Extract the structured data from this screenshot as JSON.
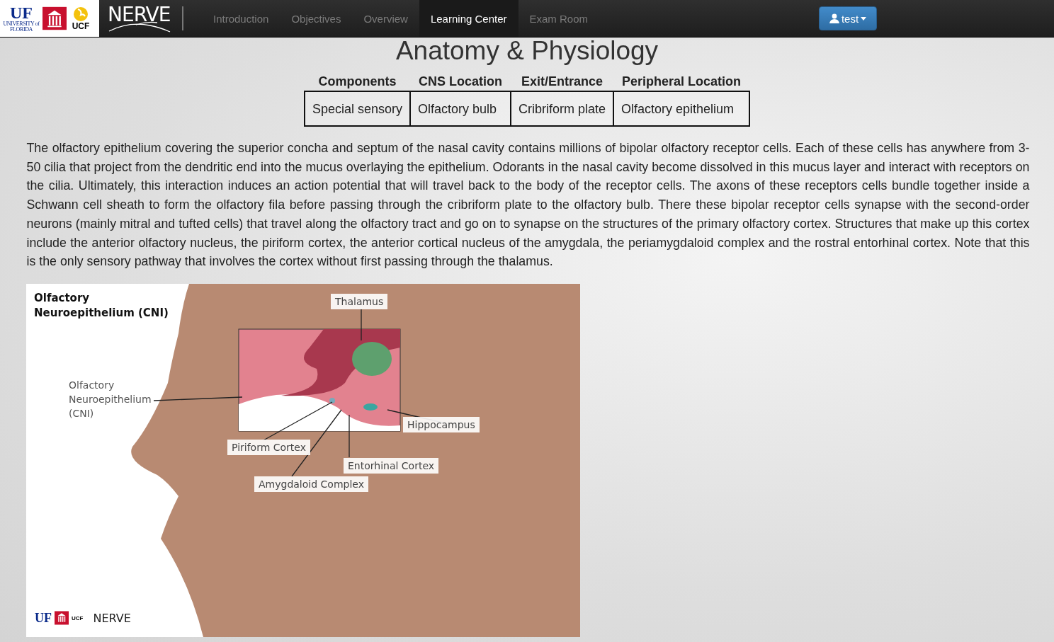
{
  "navbar": {
    "logos": {
      "uf": "UF",
      "uf_sub": "UNIVERSITY of FLORIDA",
      "ucf": "UCF"
    },
    "brand": "NERVE",
    "items": [
      {
        "label": "Introduction",
        "selected": false
      },
      {
        "label": "Objectives",
        "selected": false
      },
      {
        "label": "Overview",
        "selected": false
      },
      {
        "label": "Learning Center",
        "selected": true
      },
      {
        "label": "Exam Room",
        "selected": false
      }
    ],
    "user_button": "test"
  },
  "title": "Anatomy & Physiology",
  "summary_table": {
    "columns": [
      "Components",
      "CNS Location",
      "Exit/Entrance",
      "Peripheral Location"
    ],
    "row": [
      "Special sensory",
      "Olfactory bulb",
      "Cribriform plate",
      "Olfactory epithelium"
    ]
  },
  "description": "The olfactory epithelium covering the superior concha and septum of the nasal cavity contains millions of bipolar olfactory receptor cells. Each of these cells has anywhere from 3-50 cilia that project from the dendritic end into the mucus overlaying the epithelium. Odorants in the nasal cavity become dissolved in this mucus layer and interact with receptors on the cilia. Ultimately, this interaction induces an action potential that will travel back to the body of the receptor cells. The axons of these receptors cells bundle together inside a Schwann cell sheath to form the olfactory fila before passing through the cribriform plate to the olfactory bulb. There these bipolar receptor cells synapse with the second-order neurons (mainly mitral and tufted cells) that travel along the olfactory tract and go on to synapse on the structures of the primary olfactory cortex. Structures that make up this cortex include the anterior olfactory nucleus, the piriform cortex, the anterior cortical nucleus of the amygdala, the periamygdaloid complex and the rostral entorhinal cortex. Note that this is the only sensory pathway that involves the cortex without first passing through the thalamus.",
  "figure": {
    "heading": "Olfactory Neuroepithelium (CNI)",
    "labels": [
      "Thalamus",
      "Olfactory Neuroepithelium (CNI)",
      "Hippocampus",
      "Piriform Cortex",
      "Entorhinal Cortex",
      "Amygdaloid Complex"
    ],
    "footer_logos": {
      "uf": "UF",
      "ucf": "UCF",
      "brand": "NERVE"
    }
  }
}
